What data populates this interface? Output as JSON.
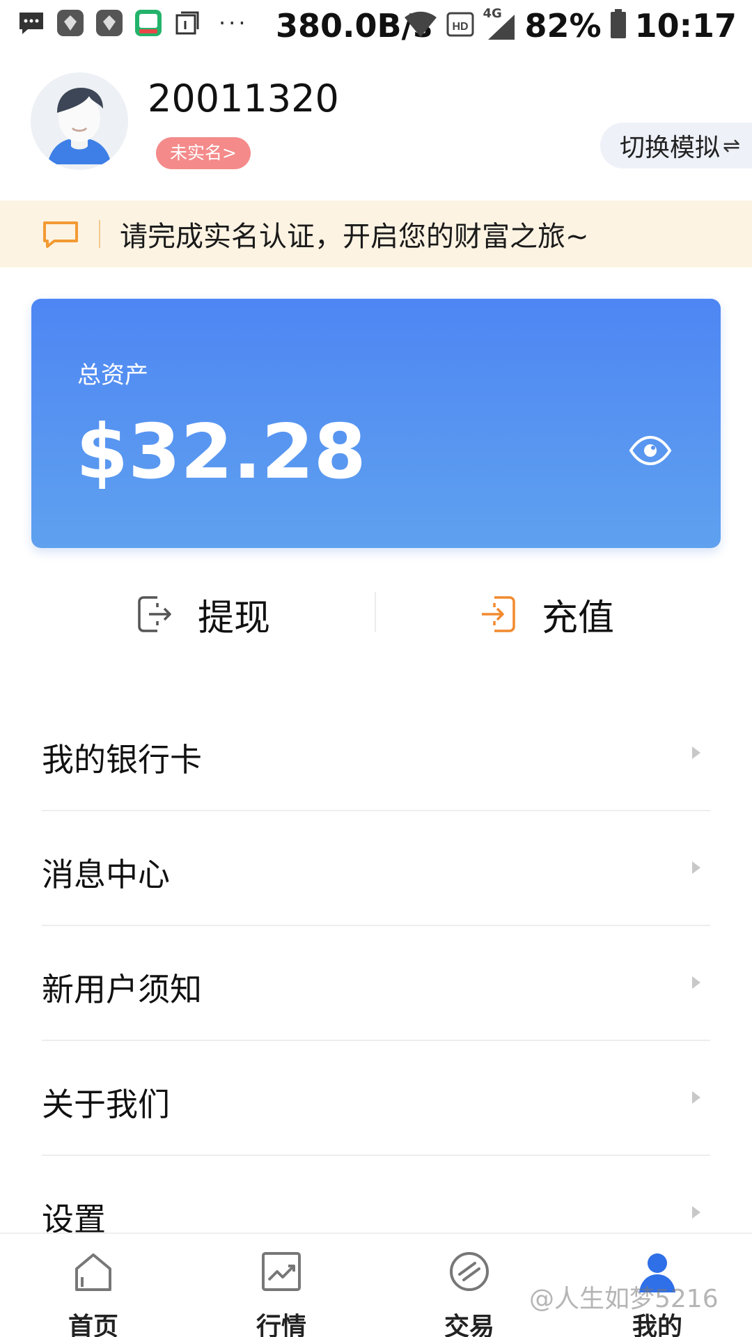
{
  "status_bar": {
    "net_speed": "380.0B/s",
    "network": "4G",
    "battery": "82%",
    "time": "10:17",
    "icons": [
      "message-icon",
      "app-icon",
      "app-icon",
      "qu-app-icon",
      "calendar-icon",
      "more-icon",
      "wifi-icon",
      "hd-icon",
      "signal-icon",
      "battery-icon"
    ]
  },
  "profile": {
    "user_id": "20011320",
    "verify_badge": "未实名>",
    "switch_label": "切换模拟"
  },
  "notice": {
    "text": "请完成实名认证，开启您的财富之旅~"
  },
  "asset_card": {
    "label": "总资产",
    "amount": "$32.28"
  },
  "actions": {
    "withdraw_label": "提现",
    "deposit_label": "充值",
    "accent": "#f28a2e"
  },
  "menu": {
    "items": [
      {
        "label": "我的银行卡"
      },
      {
        "label": "消息中心"
      },
      {
        "label": "新用户须知"
      },
      {
        "label": "关于我们"
      },
      {
        "label": "设置"
      }
    ]
  },
  "tabbar": {
    "tabs": [
      {
        "label": "首页",
        "icon": "home-icon"
      },
      {
        "label": "行情",
        "icon": "chart-icon"
      },
      {
        "label": "交易",
        "icon": "trade-icon"
      },
      {
        "label": "我的",
        "icon": "user-icon"
      }
    ],
    "active_color": "#2f6fe8"
  },
  "watermark": "@人生如梦5216"
}
